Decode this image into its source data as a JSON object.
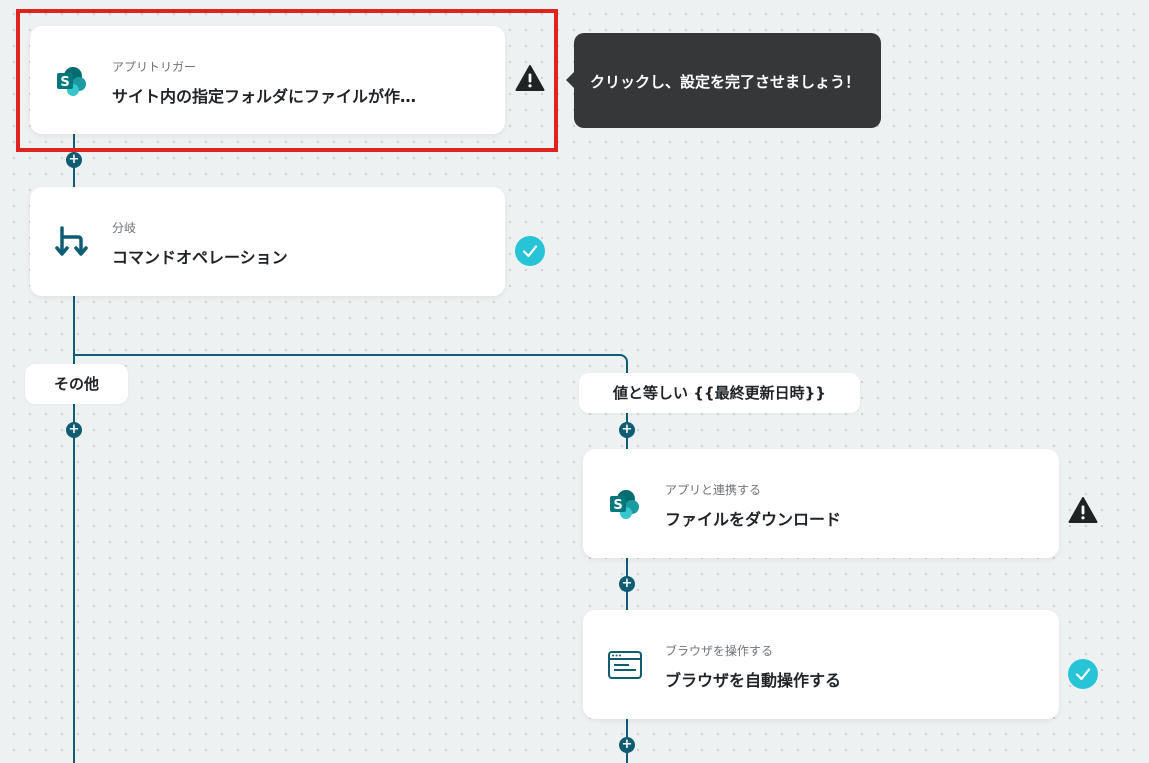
{
  "tooltip": {
    "text": "クリックし、設定を完了させましょう！"
  },
  "steps": [
    {
      "subtitle": "アプリトリガー",
      "title": "サイト内の指定フォルダにファイルが作…",
      "icon": "sharepoint-icon",
      "status": "warning"
    },
    {
      "subtitle": "分岐",
      "title": "コマンドオペレーション",
      "icon": "branch-icon",
      "status": "complete"
    },
    {
      "subtitle": "アプリと連携する",
      "title": "ファイルをダウンロード",
      "icon": "sharepoint-icon",
      "status": "warning"
    },
    {
      "subtitle": "ブラウザを操作する",
      "title": "ブラウザを自動操作する",
      "icon": "browser-window-icon",
      "status": "complete"
    }
  ],
  "branches": {
    "other_label": "その他",
    "condition_label": "値と等しい {{最終更新日時}}"
  },
  "colors": {
    "connector": "#0f5c73",
    "highlight": "#e0231f",
    "complete": "#27c4d8",
    "warning": "#1f2326",
    "sharepoint_teal": "#038387",
    "tooltip_bg": "#353739"
  }
}
